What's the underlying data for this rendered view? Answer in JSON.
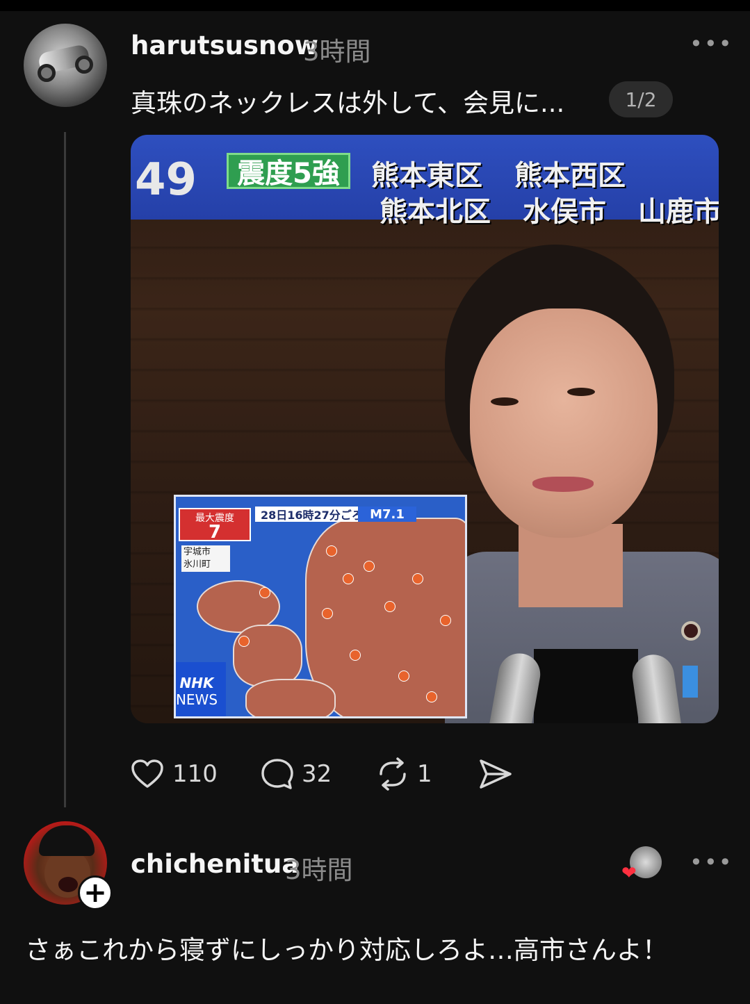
{
  "post": {
    "username": "harutsusnow",
    "time": "3時間",
    "more": "•••",
    "text": "真珠のネックレスは外して、会見に...",
    "pager": "1/2",
    "image": {
      "banner_number": "49",
      "intensity": "震度5強",
      "areas_row1": [
        "熊本東区",
        "熊本西区"
      ],
      "areas_row2": [
        "熊本北区",
        "水俣市",
        "山鹿市"
      ],
      "map_time": "28日16時27分ごろ",
      "magnitude": "M7.1",
      "max_label": "最大震度",
      "max_value": "7",
      "towns": [
        "宇城市",
        "氷川町"
      ],
      "network_line1": "NHK",
      "network_line2": "NEWS"
    },
    "actions": {
      "likes": "110",
      "comments": "32",
      "reposts": "1"
    }
  },
  "reply": {
    "username": "chichenitua",
    "time": "3時間",
    "more": "•••",
    "follow": "+",
    "text": "さぁこれから寝ずにしっかり対応しろよ…高市さんよ！"
  },
  "colors": {
    "background": "#101010",
    "text": "#f5f5f5",
    "muted": "#8c8c8c",
    "like_heart": "#ff3040"
  }
}
